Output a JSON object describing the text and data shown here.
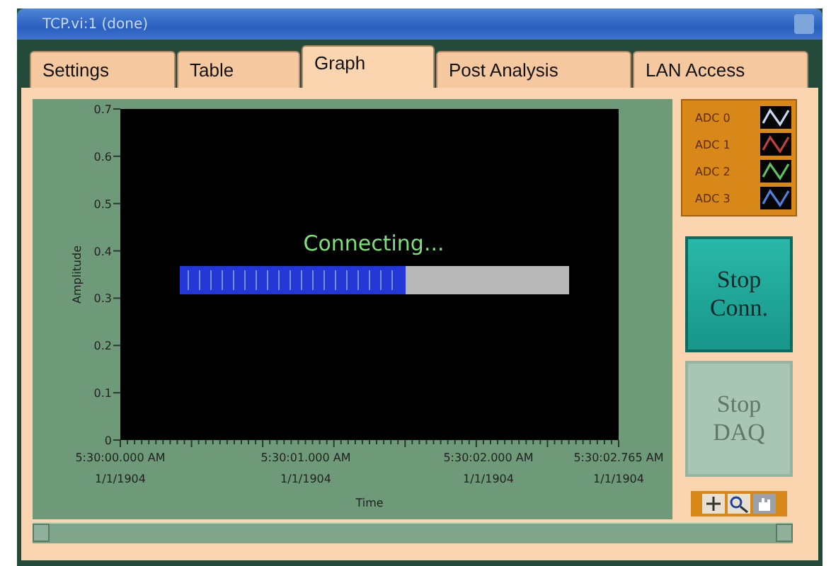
{
  "window": {
    "title": "TCP.vi:1 (done)"
  },
  "tabs": [
    {
      "label": "Settings",
      "selected": false
    },
    {
      "label": "Table",
      "selected": false
    },
    {
      "label": "Graph",
      "selected": true
    },
    {
      "label": "Post Analysis",
      "selected": false
    },
    {
      "label": "LAN Access",
      "selected": false
    }
  ],
  "graph": {
    "ylabel": "Amplitude",
    "xlabel": "Time",
    "yticks": [
      "0.7",
      "0.6",
      "0.5",
      "0.4",
      "0.3",
      "0.2",
      "0.1",
      "0"
    ],
    "xticks": [
      {
        "time": "5:30:00.000 AM",
        "date": "1/1/1904"
      },
      {
        "time": "5:30:01.000 AM",
        "date": "1/1/1904"
      },
      {
        "time": "5:30:02.000 AM",
        "date": "1/1/1904"
      },
      {
        "time": "5:30:02.765 AM",
        "date": "1/1/1904"
      }
    ],
    "status": "Connecting...",
    "progress": {
      "level": 0.58
    }
  },
  "legend": [
    {
      "name": "ADC 0",
      "color": "#c8d8f0"
    },
    {
      "name": "ADC 1",
      "color": "#c04040"
    },
    {
      "name": "ADC 2",
      "color": "#60c060"
    },
    {
      "name": "ADC 3",
      "color": "#5080e0"
    }
  ],
  "buttons": [
    {
      "label": "Stop Conn.",
      "disabled": false
    },
    {
      "label": "Stop DAQ",
      "disabled": true
    }
  ]
}
